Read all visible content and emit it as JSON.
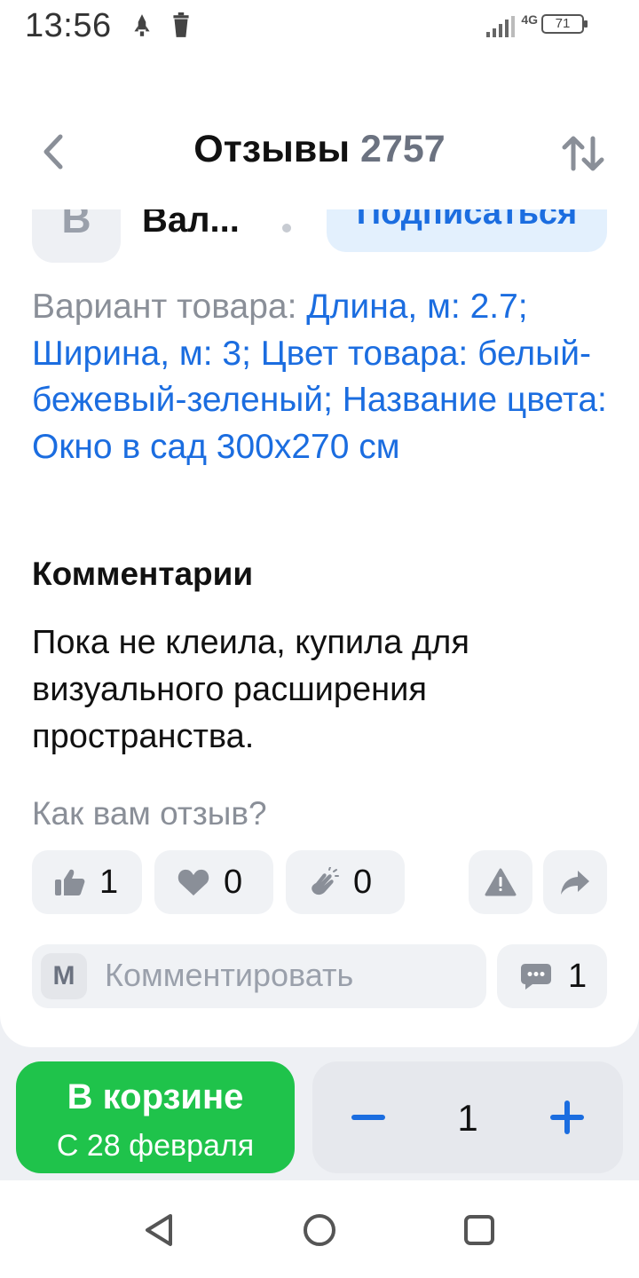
{
  "status_bar": {
    "time": "13:56",
    "network": "4G",
    "battery": "71"
  },
  "header": {
    "title": "Отзывы",
    "count": "2757"
  },
  "review": {
    "author_initial": "В",
    "author_name": "Вал...",
    "subscribe_label": "Подписаться",
    "variant_label": "Вариант товара:",
    "variant_value": "Длина, м: 2.7; Ширина, м: 3; Цвет товара: белый-бежевый-зеленый; Название цвета: Окно в сад 300x270 см",
    "comments_heading": "Комментарии",
    "comment_text": "Пока не клеила, купила для визуального расширения пространства.",
    "rate_question": "Как вам отзыв?",
    "reactions": {
      "like": "1",
      "heart": "0",
      "clap": "0"
    },
    "comment_initial": "М",
    "comment_placeholder": "Комментировать",
    "comment_count": "1"
  },
  "bottom": {
    "cart_label": "В корзине",
    "cart_date": "С 28 февраля",
    "quantity": "1"
  },
  "colors": {
    "accent": "#1b6de0",
    "cart_green": "#1fc34b",
    "muted": "#8a8f98"
  }
}
